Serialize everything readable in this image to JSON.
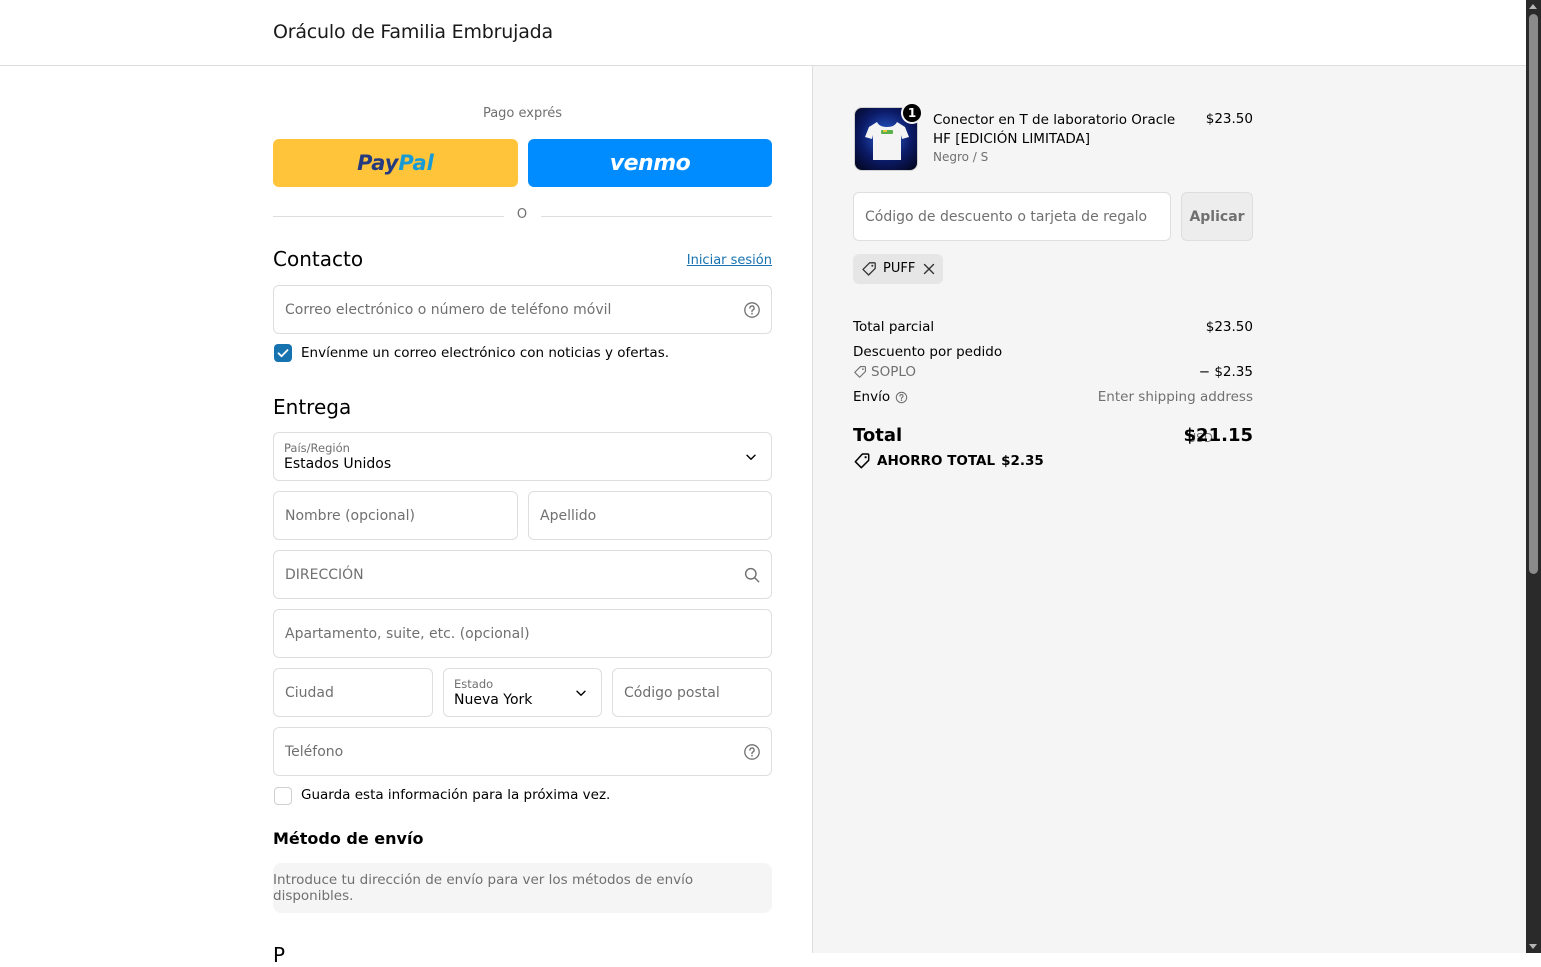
{
  "header": {
    "store_name": "Oráculo de Familia Embrujada"
  },
  "express": {
    "label": "Pago exprés",
    "paypal": {
      "part1": "Pay",
      "part2": "Pal"
    },
    "venmo": "venmo",
    "divider": "O"
  },
  "contact": {
    "title": "Contacto",
    "login_link": "Iniciar sesión",
    "email_placeholder": "Correo electrónico o número de teléfono móvil",
    "newsletter_label": "Envíenme un correo electrónico con noticias y ofertas.",
    "newsletter_checked": true
  },
  "delivery": {
    "title": "Entrega",
    "country_label": "País/Región",
    "country_value": "Estados Unidos",
    "first_name_placeholder": "Nombre (opcional)",
    "last_name_placeholder": "Apellido",
    "address_placeholder": "DIRECCIÓN",
    "apartment_placeholder": "Apartamento, suite, etc. (opcional)",
    "city_placeholder": "Ciudad",
    "state_label": "Estado",
    "state_value": "Nueva York",
    "zip_placeholder": "Código postal",
    "phone_placeholder": "Teléfono",
    "save_info_label": "Guarda esta información para la próxima vez.",
    "save_info_checked": false
  },
  "shipping_method": {
    "title": "Método de envío",
    "message": "Introduce tu dirección de envío para ver los métodos de envío disponibles."
  },
  "next_section_title": "P",
  "summary": {
    "product": {
      "name": "Conector en T de laboratorio Oracle HF [EDICIÓN LIMITADA]",
      "variant": "Negro / S",
      "price": "$23.50",
      "quantity": "1"
    },
    "discount_placeholder": "Código de descuento o tarjeta de regalo",
    "apply_label": "Aplicar",
    "applied_code": "PUFF",
    "subtotal_label": "Total parcial",
    "subtotal_value": "$23.50",
    "order_discount_label": "Descuento por pedido",
    "order_discount_code": "SOPLO",
    "order_discount_value": "− $2.35",
    "shipping_label": "Envío",
    "shipping_value": "Enter shipping address",
    "total_label": "Total",
    "currency": "USD",
    "total_value": "$21.15",
    "savings_label": "AHORRO TOTAL",
    "savings_value": "$2.35"
  }
}
